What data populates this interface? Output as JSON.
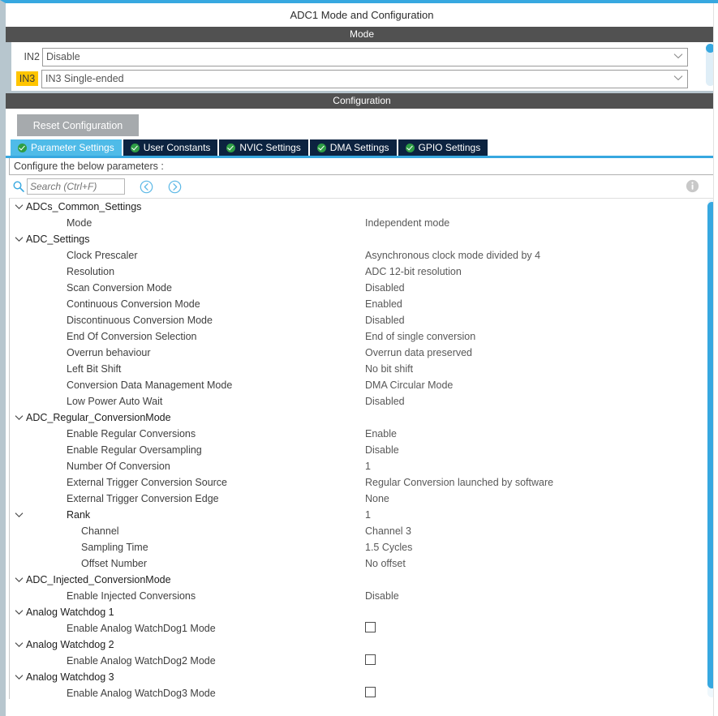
{
  "window": {
    "title": "ADC1 Mode and Configuration"
  },
  "colors": {
    "accent_blue": "#37a8e0",
    "tab_active": "#4fbbe8",
    "tab_inactive": "#0c2340",
    "header_bar": "#515151",
    "highlight_yellow": "#ffc500",
    "highlight_pink": "#e6007e",
    "check_green": "#2e9e45",
    "button_gray": "#a6aaad"
  },
  "mode": {
    "header": "Mode",
    "rows": [
      {
        "label": "IN2",
        "highlight": "none",
        "value": "Disable"
      },
      {
        "label": "IN3",
        "highlight": "yellow",
        "value": "IN3 Single-ended"
      },
      {
        "label": "",
        "highlight": "pink",
        "value": ""
      }
    ]
  },
  "configuration": {
    "header": "Configuration",
    "reset_label": "Reset Configuration",
    "tabs": [
      {
        "label": "Parameter Settings",
        "active": true
      },
      {
        "label": "User Constants",
        "active": false
      },
      {
        "label": "NVIC Settings",
        "active": false
      },
      {
        "label": "DMA Settings",
        "active": false
      },
      {
        "label": "GPIO Settings",
        "active": false
      }
    ],
    "configure_hint": "Configure the below parameters :",
    "search": {
      "placeholder": "Search (Ctrl+F)",
      "value": ""
    },
    "tree": [
      {
        "type": "group",
        "indent": 0,
        "expanded": true,
        "name": "ADCs_Common_Settings",
        "value": ""
      },
      {
        "type": "item",
        "indent": 1,
        "name": "Mode",
        "value": "Independent mode"
      },
      {
        "type": "group",
        "indent": 0,
        "expanded": true,
        "name": "ADC_Settings",
        "value": ""
      },
      {
        "type": "item",
        "indent": 1,
        "name": "Clock Prescaler",
        "value": "Asynchronous clock mode divided by 4"
      },
      {
        "type": "item",
        "indent": 1,
        "name": "Resolution",
        "value": "ADC 12-bit resolution"
      },
      {
        "type": "item",
        "indent": 1,
        "name": "Scan Conversion Mode",
        "value": "Disabled"
      },
      {
        "type": "item",
        "indent": 1,
        "name": "Continuous Conversion Mode",
        "value": "Enabled"
      },
      {
        "type": "item",
        "indent": 1,
        "name": "Discontinuous Conversion Mode",
        "value": "Disabled"
      },
      {
        "type": "item",
        "indent": 1,
        "name": "End Of Conversion Selection",
        "value": "End of single conversion"
      },
      {
        "type": "item",
        "indent": 1,
        "name": "Overrun behaviour",
        "value": "Overrun data preserved"
      },
      {
        "type": "item",
        "indent": 1,
        "name": "Left Bit Shift",
        "value": "No bit shift"
      },
      {
        "type": "item",
        "indent": 1,
        "name": "Conversion Data Management Mode",
        "value": "DMA Circular Mode"
      },
      {
        "type": "item",
        "indent": 1,
        "name": "Low Power Auto Wait",
        "value": "Disabled"
      },
      {
        "type": "group",
        "indent": 0,
        "expanded": true,
        "name": "ADC_Regular_ConversionMode",
        "value": ""
      },
      {
        "type": "item",
        "indent": 1,
        "name": "Enable Regular Conversions",
        "value": "Enable"
      },
      {
        "type": "item",
        "indent": 1,
        "name": "Enable Regular Oversampling",
        "value": "Disable"
      },
      {
        "type": "item",
        "indent": 1,
        "name": "Number Of Conversion",
        "value": "1"
      },
      {
        "type": "item",
        "indent": 1,
        "name": "External Trigger Conversion Source",
        "value": "Regular Conversion launched by software"
      },
      {
        "type": "item",
        "indent": 1,
        "name": "External Trigger Conversion Edge",
        "value": "None"
      },
      {
        "type": "group",
        "indent": 1,
        "expanded": true,
        "name": "Rank",
        "value": "1"
      },
      {
        "type": "item",
        "indent": 2,
        "name": "Channel",
        "value": "Channel 3"
      },
      {
        "type": "item",
        "indent": 2,
        "name": "Sampling Time",
        "value": "1.5 Cycles"
      },
      {
        "type": "item",
        "indent": 2,
        "name": "Offset Number",
        "value": "No offset"
      },
      {
        "type": "group",
        "indent": 0,
        "expanded": true,
        "name": "ADC_Injected_ConversionMode",
        "value": ""
      },
      {
        "type": "item",
        "indent": 1,
        "name": "Enable Injected Conversions",
        "value": "Disable"
      },
      {
        "type": "group",
        "indent": 0,
        "expanded": true,
        "name": "Analog Watchdog 1",
        "value": ""
      },
      {
        "type": "checkbox",
        "indent": 1,
        "name": "Enable Analog WatchDog1 Mode",
        "checked": false
      },
      {
        "type": "group",
        "indent": 0,
        "expanded": true,
        "name": "Analog Watchdog 2",
        "value": ""
      },
      {
        "type": "checkbox",
        "indent": 1,
        "name": "Enable Analog WatchDog2 Mode",
        "checked": false
      },
      {
        "type": "group",
        "indent": 0,
        "expanded": true,
        "name": "Analog Watchdog 3",
        "value": ""
      },
      {
        "type": "checkbox",
        "indent": 1,
        "name": "Enable Analog WatchDog3 Mode",
        "checked": false
      }
    ]
  }
}
